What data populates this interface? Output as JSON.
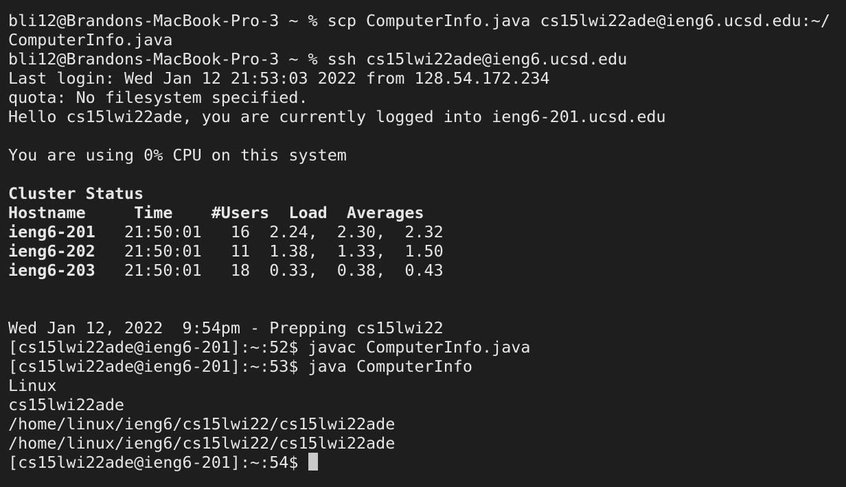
{
  "colors": {
    "background": "#1e1e1e",
    "foreground": "#e6e6e6",
    "cursor": "#c9c9c9"
  },
  "lines": [
    {
      "text": "bli12@Brandons-MacBook-Pro-3 ~ % scp ComputerInfo.java cs15lwi22ade@ieng6.ucsd.edu:~/",
      "bold": false
    },
    {
      "text": "ComputerInfo.java",
      "bold": false
    },
    {
      "text": "bli12@Brandons-MacBook-Pro-3 ~ % ssh cs15lwi22ade@ieng6.ucsd.edu",
      "bold": false
    },
    {
      "text": "Last login: Wed Jan 12 21:53:03 2022 from 128.54.172.234",
      "bold": false
    },
    {
      "text": "quota: No filesystem specified.",
      "bold": false
    },
    {
      "text": "Hello cs15lwi22ade, you are currently logged into ieng6-201.ucsd.edu",
      "bold": false
    },
    {
      "text": "",
      "bold": false
    },
    {
      "text": "You are using 0% CPU on this system",
      "bold": false
    },
    {
      "text": "",
      "bold": false
    },
    {
      "text": "Cluster Status",
      "bold": true
    },
    {
      "text": "Hostname     Time    #Users  Load  Averages",
      "bold": true
    },
    {
      "text": "ieng6-201",
      "bold": true,
      "rest": "   21:50:01   16  2.24,  2.30,  2.32"
    },
    {
      "text": "ieng6-202",
      "bold": true,
      "rest": "   21:50:01   11  1.38,  1.33,  1.50"
    },
    {
      "text": "ieng6-203",
      "bold": true,
      "rest": "   21:50:01   18  0.33,  0.38,  0.43"
    },
    {
      "text": "",
      "bold": false
    },
    {
      "text": "",
      "bold": false
    },
    {
      "text": "Wed Jan 12, 2022  9:54pm - Prepping cs15lwi22",
      "bold": false
    },
    {
      "text": "[cs15lwi22ade@ieng6-201]:~:52$ javac ComputerInfo.java",
      "bold": false
    },
    {
      "text": "[cs15lwi22ade@ieng6-201]:~:53$ java ComputerInfo",
      "bold": false
    },
    {
      "text": "Linux",
      "bold": false
    },
    {
      "text": "cs15lwi22ade",
      "bold": false
    },
    {
      "text": "/home/linux/ieng6/cs15lwi22/cs15lwi22ade",
      "bold": false
    },
    {
      "text": "/home/linux/ieng6/cs15lwi22/cs15lwi22ade",
      "bold": false
    }
  ],
  "prompt": {
    "text": "[cs15lwi22ade@ieng6-201]:~:54$ "
  }
}
